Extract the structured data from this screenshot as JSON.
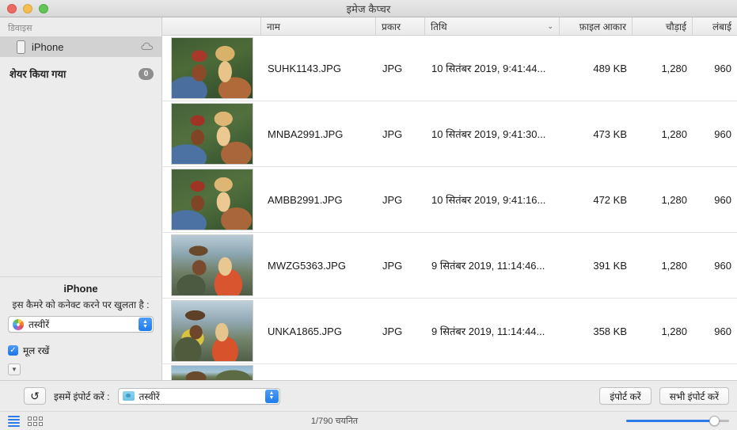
{
  "window": {
    "title": "इमेज कैप्चर",
    "traffic_lights": [
      "close-button",
      "minimize-button",
      "maximize-button"
    ]
  },
  "sidebar": {
    "devices_header": "डिवाइस",
    "device": {
      "label": "iPhone",
      "icon": "iphone-icon",
      "cloud_icon": "cloud-icon",
      "selected": true
    },
    "shared": {
      "label": "शेयर किया गया",
      "count": "0"
    },
    "info": {
      "device_name": "iPhone",
      "description": "इस कैमरे को कनेक्ट करने पर खुलता है :",
      "app_popup": {
        "value": "तस्वीरें",
        "icon": "photos-app-icon"
      },
      "keep_originals": {
        "label": "मूल रखें",
        "checked": true
      },
      "disclosure_icon": "disclosure-triangle-icon"
    }
  },
  "columns": [
    {
      "key": "thumbnail",
      "label": ""
    },
    {
      "key": "name",
      "label": "नाम"
    },
    {
      "key": "type",
      "label": "प्रकार"
    },
    {
      "key": "date",
      "label": "तिथि",
      "sorted": true,
      "sort_icon": "chevron-down-icon"
    },
    {
      "key": "size",
      "label": "फ़ाइल आकार"
    },
    {
      "key": "width",
      "label": "चौड़ाई"
    },
    {
      "key": "height",
      "label": "लंबाई"
    }
  ],
  "rows": [
    {
      "name": "SUHK1143.JPG",
      "type": "JPG",
      "date": "10 सितंबर 2019, 9:41:44...",
      "size": "489 KB",
      "width": "1,280",
      "height": "960",
      "thumb_class": "ph-a"
    },
    {
      "name": "MNBA2991.JPG",
      "type": "JPG",
      "date": "10 सितंबर 2019, 9:41:30...",
      "size": "473 KB",
      "width": "1,280",
      "height": "960",
      "thumb_class": "ph-b"
    },
    {
      "name": "AMBB2991.JPG",
      "type": "JPG",
      "date": "10 सितंबर 2019, 9:41:16...",
      "size": "472 KB",
      "width": "1,280",
      "height": "960",
      "thumb_class": "ph-b"
    },
    {
      "name": "MWZG5363.JPG",
      "type": "JPG",
      "date": "9 सितंबर 2019, 11:14:46...",
      "size": "391 KB",
      "width": "1,280",
      "height": "960",
      "thumb_class": "ph-c"
    },
    {
      "name": "UNKA1865.JPG",
      "type": "JPG",
      "date": "9 सितंबर 2019, 11:14:44...",
      "size": "358 KB",
      "width": "1,280",
      "height": "960",
      "thumb_class": "ph-d"
    }
  ],
  "partial_row": {
    "thumb_class": "ph-e"
  },
  "bottombar": {
    "rotate_icon": "rotate-icon",
    "import_to_label": "इसमें इंपोर्ट करें :",
    "destination": {
      "value": "तस्वीरें",
      "icon": "folder-icon"
    },
    "import_button": "इंपोर्ट करें",
    "import_all_button": "सभी इंपोर्ट करें",
    "view_list_icon": "list-view-icon",
    "view_grid_icon": "grid-view-icon",
    "status": "1/790 चयनित",
    "zoom_slider": {
      "value": 85
    }
  },
  "colors": {
    "accent": "#2b7bea",
    "window_chrome": "#ececec",
    "selected_row": "#d2d2d2"
  }
}
